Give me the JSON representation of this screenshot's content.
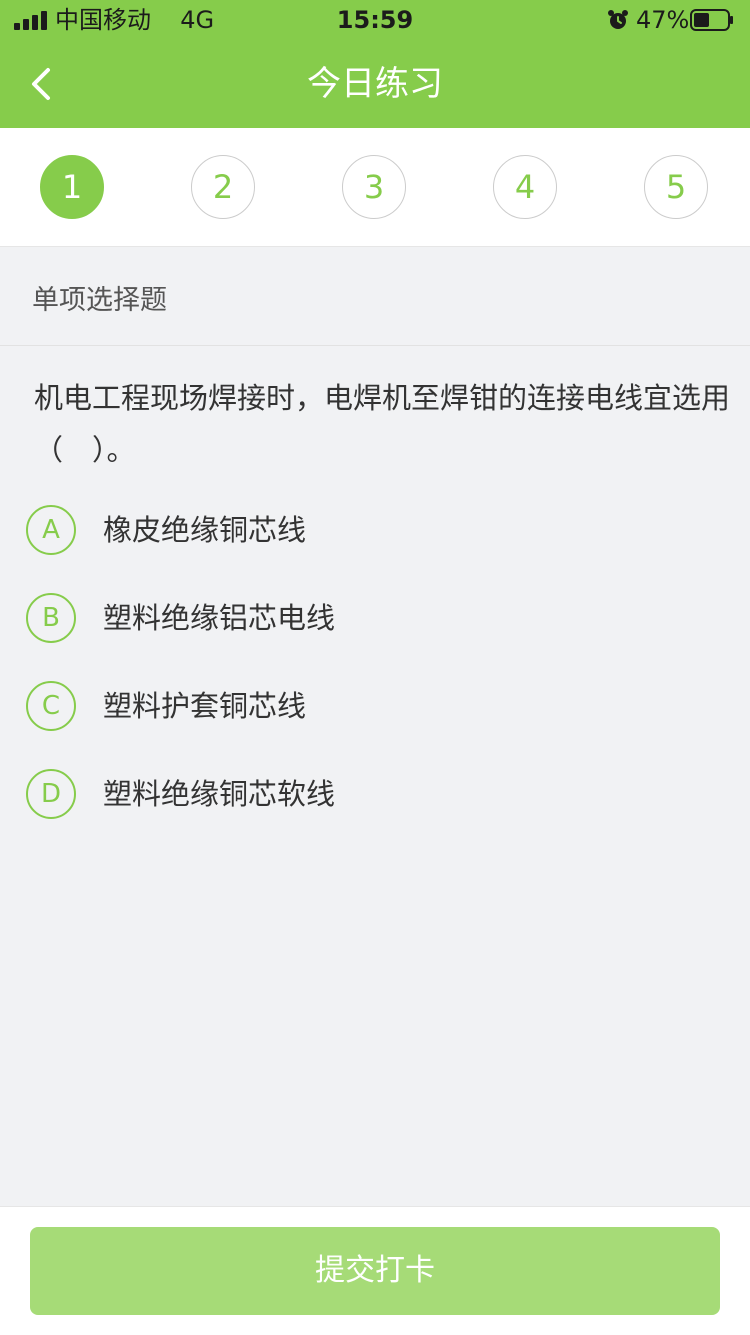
{
  "status_bar": {
    "carrier": "中国移动",
    "network": "4G",
    "time": "15:59",
    "battery_percent": "47%",
    "battery_level": 0.47,
    "icons": [
      "signal-icon",
      "alarm-icon",
      "battery-icon"
    ]
  },
  "nav": {
    "title": "今日练习",
    "back_icon": "chevron-left-icon"
  },
  "stepper": {
    "steps": [
      "1",
      "2",
      "3",
      "4",
      "5"
    ],
    "current": 1
  },
  "question": {
    "type_label": "单项选择题",
    "text": "机电工程现场焊接时，电焊机至焊钳的连接电线宜选用（　）。",
    "options": [
      {
        "letter": "A",
        "text": "橡皮绝缘铜芯线"
      },
      {
        "letter": "B",
        "text": "塑料绝缘铝芯电线"
      },
      {
        "letter": "C",
        "text": "塑料护套铜芯线"
      },
      {
        "letter": "D",
        "text": "塑料绝缘铜芯软线"
      }
    ]
  },
  "footer": {
    "submit_label": "提交打卡"
  },
  "colors": {
    "accent": "#86cc4b",
    "submit_disabled": "#a6db77",
    "background": "#f1f2f4"
  }
}
